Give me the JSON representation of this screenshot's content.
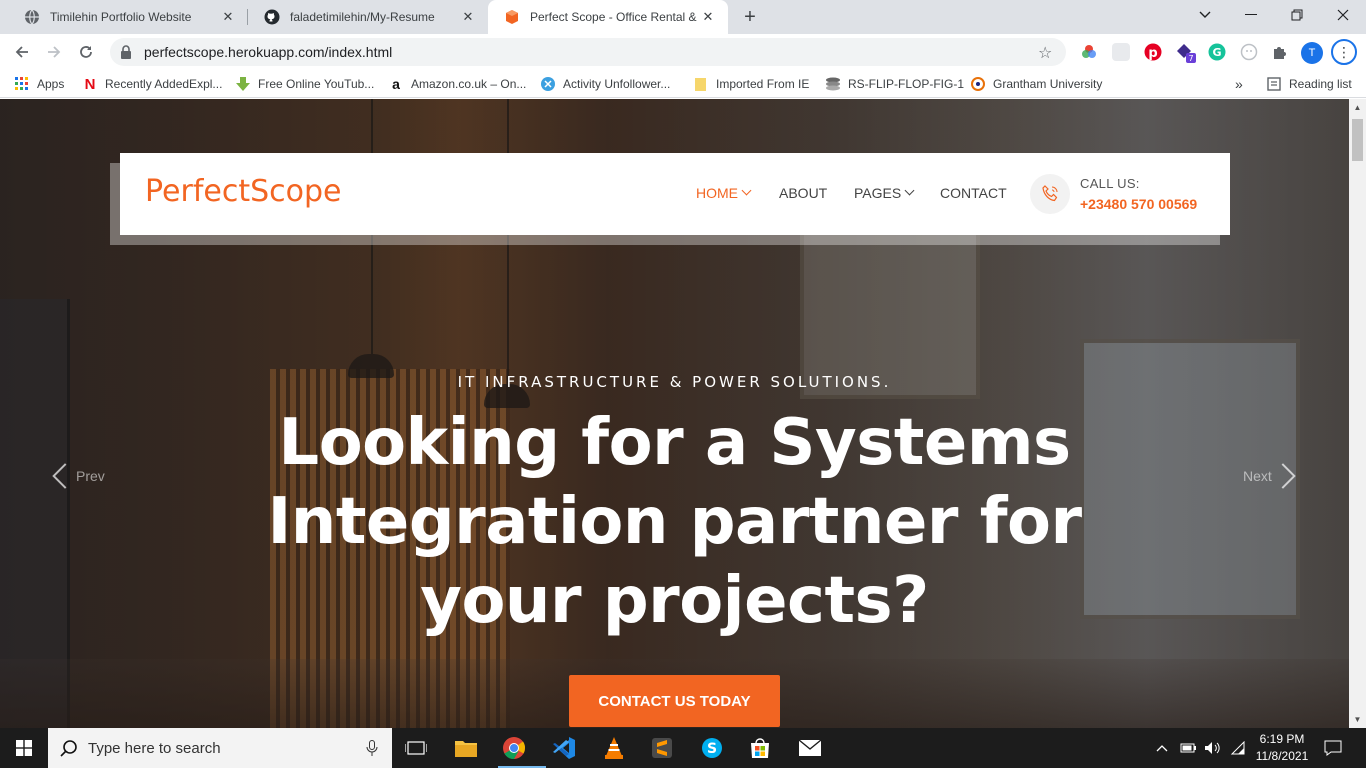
{
  "browser": {
    "tabs": [
      {
        "title": "Timilehin Portfolio Website",
        "active": false
      },
      {
        "title": "faladetimilehin/My-Resume",
        "active": false
      },
      {
        "title": "Perfect Scope - Office Rental & C",
        "active": true
      }
    ],
    "url": "perfectscope.herokuapp.com/index.html",
    "profile_initial": "T",
    "extension_badge": "7",
    "bookmarks": [
      {
        "label": "Apps",
        "icon": "apps-grid-icon"
      },
      {
        "label": "Recently AddedExpl...",
        "icon": "netflix-icon"
      },
      {
        "label": "Free Online YouTub...",
        "icon": "download-arrow-icon"
      },
      {
        "label": "Amazon.co.uk – On...",
        "icon": "amazon-icon"
      },
      {
        "label": "Activity  Unfollower...",
        "icon": "activity-icon"
      },
      {
        "label": "Imported From IE",
        "icon": "folder-icon"
      },
      {
        "label": "RS-FLIP-FLOP-FIG-1",
        "icon": "stack-icon"
      },
      {
        "label": "Grantham University",
        "icon": "grantham-icon"
      }
    ],
    "reading_list": "Reading list",
    "more_bookmarks": "»"
  },
  "site": {
    "logo": "PerfectScope",
    "nav": [
      {
        "label": "HOME",
        "dropdown": true,
        "active": true
      },
      {
        "label": "ABOUT",
        "dropdown": false,
        "active": false
      },
      {
        "label": "PAGES",
        "dropdown": true,
        "active": false
      },
      {
        "label": "CONTACT",
        "dropdown": false,
        "active": false
      }
    ],
    "call_label": "CALL US:",
    "phone": "+23480 570 00569",
    "accent": "#f26522"
  },
  "hero": {
    "tagline": "IT INFRASTRUCTURE & POWER SOLUTIONS.",
    "headline": "Looking for a Systems Integration partner for your projects?",
    "cta": "CONTACT US TODAY",
    "prev": "Prev",
    "next": "Next"
  },
  "taskbar": {
    "search_placeholder": "Type here to search",
    "time": "6:19 PM",
    "date": "11/8/2021"
  }
}
